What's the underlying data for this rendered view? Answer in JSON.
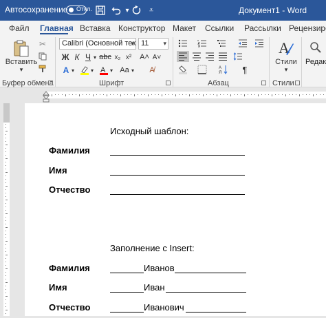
{
  "titlebar": {
    "autosave_label": "Автосохранение",
    "toggle_state": "Откл.",
    "document_title": "Документ1  -  Word"
  },
  "tabs": [
    {
      "label": "Файл"
    },
    {
      "label": "Главная"
    },
    {
      "label": "Вставка"
    },
    {
      "label": "Конструктор"
    },
    {
      "label": "Макет"
    },
    {
      "label": "Ссылки"
    },
    {
      "label": "Рассылки"
    },
    {
      "label": "Рецензиро"
    }
  ],
  "ribbon": {
    "paste_label": "Вставить",
    "font_name": "Calibri (Основной текст",
    "font_size": "11",
    "styles_label": "Стили",
    "edit_label": "Редакт",
    "groups": {
      "clipboard": "Буфер обмена",
      "font": "Шрифт",
      "paragraph": "Абзац",
      "styles": "Стили"
    }
  },
  "document": {
    "heading1": "Исходный шаблон:",
    "template": [
      {
        "label": "Фамилия"
      },
      {
        "label": "Имя"
      },
      {
        "label": "Отчество"
      }
    ],
    "heading2": "Заполнение с Insert:",
    "filled": [
      {
        "label": "Фамилия",
        "value": "Иванов"
      },
      {
        "label": "Имя",
        "value": "Иван"
      },
      {
        "label": "Отчество",
        "value": "Иванович"
      }
    ]
  },
  "colors": {
    "titlebar": "#2b579a",
    "highlight": "#ffff00",
    "font_color": "#ff0000"
  }
}
